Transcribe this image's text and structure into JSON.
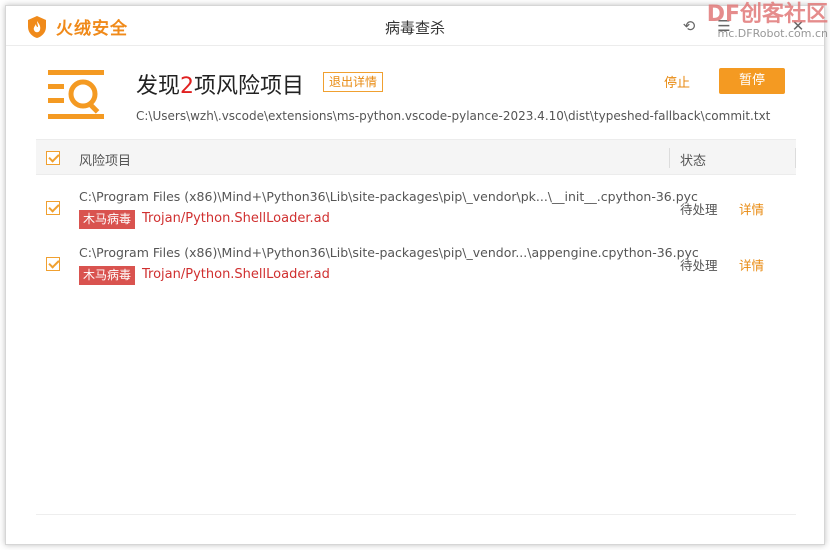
{
  "window": {
    "brand_name": "火绒安全",
    "title": "病毒查杀",
    "back_glyph": "⟲",
    "menu_glyph": "☰",
    "close_glyph": "✕"
  },
  "watermark": {
    "main": "DF创客社区",
    "url": "mc.DFRobot.com.cn"
  },
  "header": {
    "headline_prefix": "发现",
    "headline_count": "2",
    "headline_suffix": "项风险项目",
    "detail_badge": "退出详情",
    "stop_label": "停止",
    "pause_label": "暂停",
    "scan_path": "C:\\Users\\wzh\\.vscode\\extensions\\ms-python.vscode-pylance-2023.4.10\\dist\\typeshed-fallback\\commit.txt"
  },
  "table": {
    "col_name": "风险项目",
    "col_status": "状态",
    "rows": [
      {
        "path": "C:\\Program Files (x86)\\Mind+\\Python36\\Lib\\site-packages\\pip\\_vendor\\pk...\\__init__.cpython-36.pyc",
        "tag": "木马病毒",
        "virus": "Trojan/Python.ShellLoader.ad",
        "status": "待处理",
        "detail": "详情"
      },
      {
        "path": "C:\\Program Files (x86)\\Mind+\\Python36\\Lib\\site-packages\\pip\\_vendor...\\appengine.cpython-36.pyc",
        "tag": "木马病毒",
        "virus": "Trojan/Python.ShellLoader.ad",
        "status": "待处理",
        "detail": "详情"
      }
    ]
  },
  "colors": {
    "accent": "#f49a22",
    "tag_red": "#d9534f",
    "virus_red": "#d03030"
  },
  "icons": [
    "fire-shield-icon",
    "scan-list-magnifier-icon",
    "back-icon",
    "menu-icon",
    "close-icon",
    "checkbox-checked-icon"
  ]
}
